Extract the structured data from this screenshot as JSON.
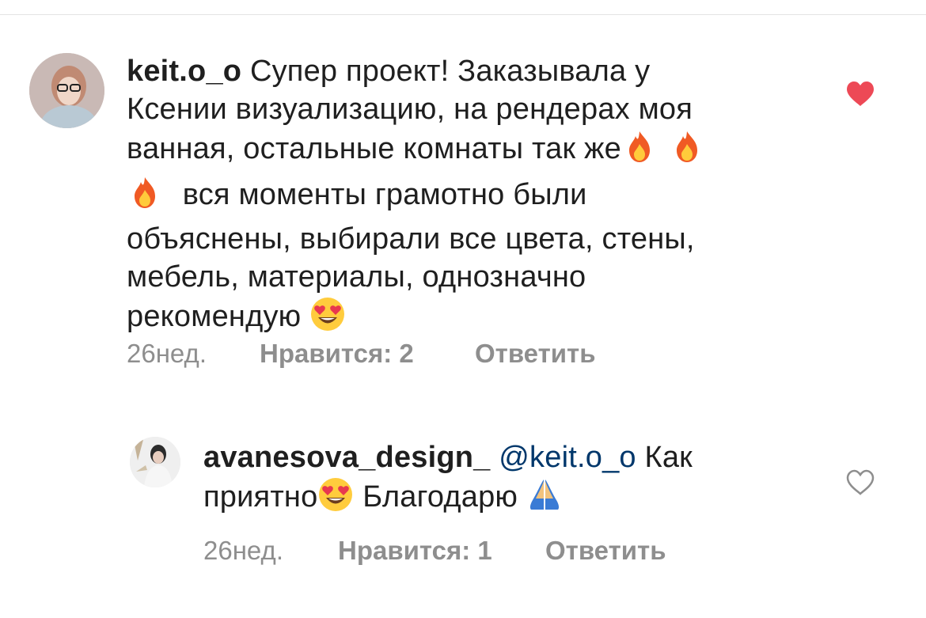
{
  "comments": [
    {
      "username": "keit.o_o",
      "text_line1": "Супер проект! Заказывала у",
      "text_line2": "Ксении визуализацию, на рендерах моя",
      "text_line3": "ванная, остальные комнаты так же",
      "text_line4": "вся моменты грамотно были",
      "text_line5": "объяснены, выбирали все цвета, стены,",
      "text_line6": "мебель, материалы, однозначно",
      "text_line7": "рекомендую",
      "time": "26нед.",
      "likes": "Нравится: 2",
      "reply": "Ответить",
      "liked": true,
      "emojis": [
        "fire-emoji",
        "fire-emoji",
        "fire-emoji",
        "heart-eyes-emoji"
      ]
    },
    {
      "username": "avanesova_design_",
      "mention": "@keit.o_o",
      "text_part1": "Как",
      "text_part2": "приятно",
      "text_part3": "Благодарю",
      "time": "26нед.",
      "likes": "Нравится: 1",
      "reply": "Ответить",
      "liked": false,
      "emojis": [
        "heart-eyes-emoji",
        "folded-hands-emoji"
      ]
    }
  ],
  "colors": {
    "like_red": "#ed4956",
    "meta_gray": "#8e8e8e",
    "mention_blue": "#00376b",
    "divider": "#e3e3e3"
  }
}
